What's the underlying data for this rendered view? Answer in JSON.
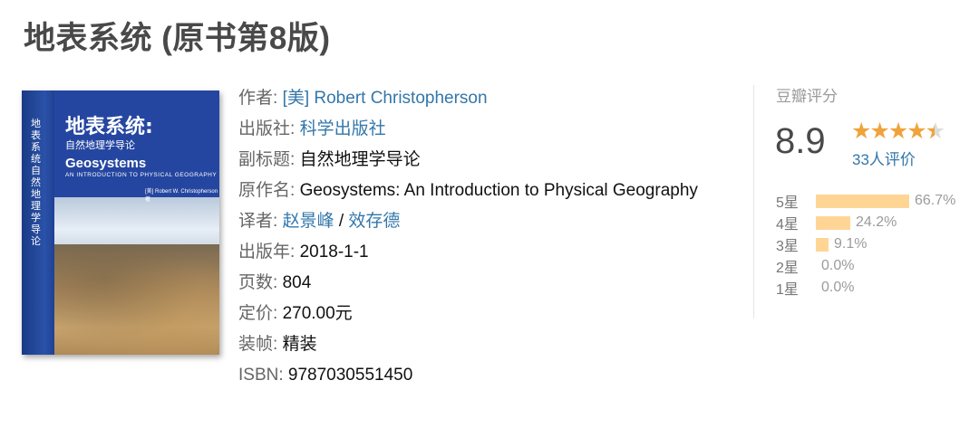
{
  "title": "地表系统 (原书第8版)",
  "cover": {
    "title_cn": "地表系统:",
    "subtitle_cn": "自然地理学导论",
    "title_en": "Geosystems",
    "subtitle_en": "AN INTRODUCTION TO PHYSICAL GEOGRAPHY",
    "author": "[美] Robert W. Christopherson 著",
    "spine": "地表系统自然地理学导论"
  },
  "info": {
    "author_label": "作者:",
    "author_value": "[美] Robert Christopherson",
    "publisher_label": "出版社:",
    "publisher_value": "科学出版社",
    "subtitle_label": "副标题:",
    "subtitle_value": "自然地理学导论",
    "original_label": "原作名:",
    "original_value": "Geosystems: An Introduction to Physical Geography",
    "translator_label": "译者:",
    "translator_1": "赵景峰",
    "translator_sep": " / ",
    "translator_2": "效存德",
    "pubyear_label": "出版年:",
    "pubyear_value": "2018-1-1",
    "pages_label": "页数:",
    "pages_value": "804",
    "price_label": "定价:",
    "price_value": "270.00元",
    "binding_label": "装帧:",
    "binding_value": "精装",
    "isbn_label": "ISBN:",
    "isbn_value": "9787030551450"
  },
  "rating": {
    "title": "豆瓣评分",
    "score": "8.9",
    "stars_value": 4.5,
    "votes": "33人评价",
    "accent": "#f0a33b",
    "bar_color": "#ffd596",
    "breakdown": [
      {
        "label": "5星",
        "pct": "66.7%",
        "fraction": 0.667
      },
      {
        "label": "4星",
        "pct": "24.2%",
        "fraction": 0.242
      },
      {
        "label": "3星",
        "pct": "9.1%",
        "fraction": 0.091
      },
      {
        "label": "2星",
        "pct": "0.0%",
        "fraction": 0.0
      },
      {
        "label": "1星",
        "pct": "0.0%",
        "fraction": 0.0
      }
    ]
  },
  "colors": {
    "link": "#3377aa",
    "title": "#494949",
    "label": "#666666"
  }
}
